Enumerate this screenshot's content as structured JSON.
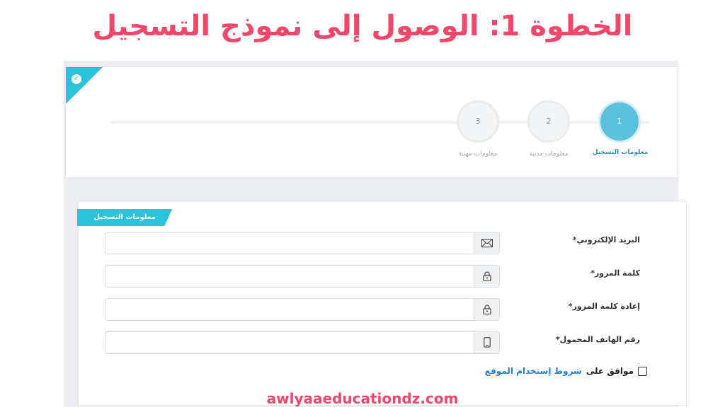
{
  "headline": "الخطوة 1: الوصول إلى نموذج التسجيل",
  "stepper": {
    "steps": [
      {
        "number": "1",
        "label": "معلومات التسجيل",
        "active": true
      },
      {
        "number": "2",
        "label": "معلومات مدنية",
        "active": false
      },
      {
        "number": "3",
        "label": "معلومات مهنية",
        "active": false
      }
    ]
  },
  "form": {
    "section_title": "معلومات التسجيل",
    "fields": [
      {
        "label": "البريد الإلكتروني*",
        "icon": "envelope-icon",
        "value": "",
        "placeholder": ""
      },
      {
        "label": "كلمة المرور*",
        "icon": "lock-icon",
        "value": "",
        "placeholder": ""
      },
      {
        "label": "إعادة كلمة المرور*",
        "icon": "lock-icon",
        "value": "",
        "placeholder": ""
      },
      {
        "label": "رقم الهاتف المحمول*",
        "icon": "mobile-icon",
        "value": "",
        "placeholder": ""
      }
    ],
    "agree_text": "موافق على",
    "terms_link": "شروط إستخدام الموقع"
  },
  "footer": {
    "site": "awlyaaeducationdz.com"
  },
  "colors": {
    "accent": "#2bc3d9",
    "active_step": "#5bc0de",
    "headline": "#f0476a",
    "link": "#1f7fd1"
  }
}
